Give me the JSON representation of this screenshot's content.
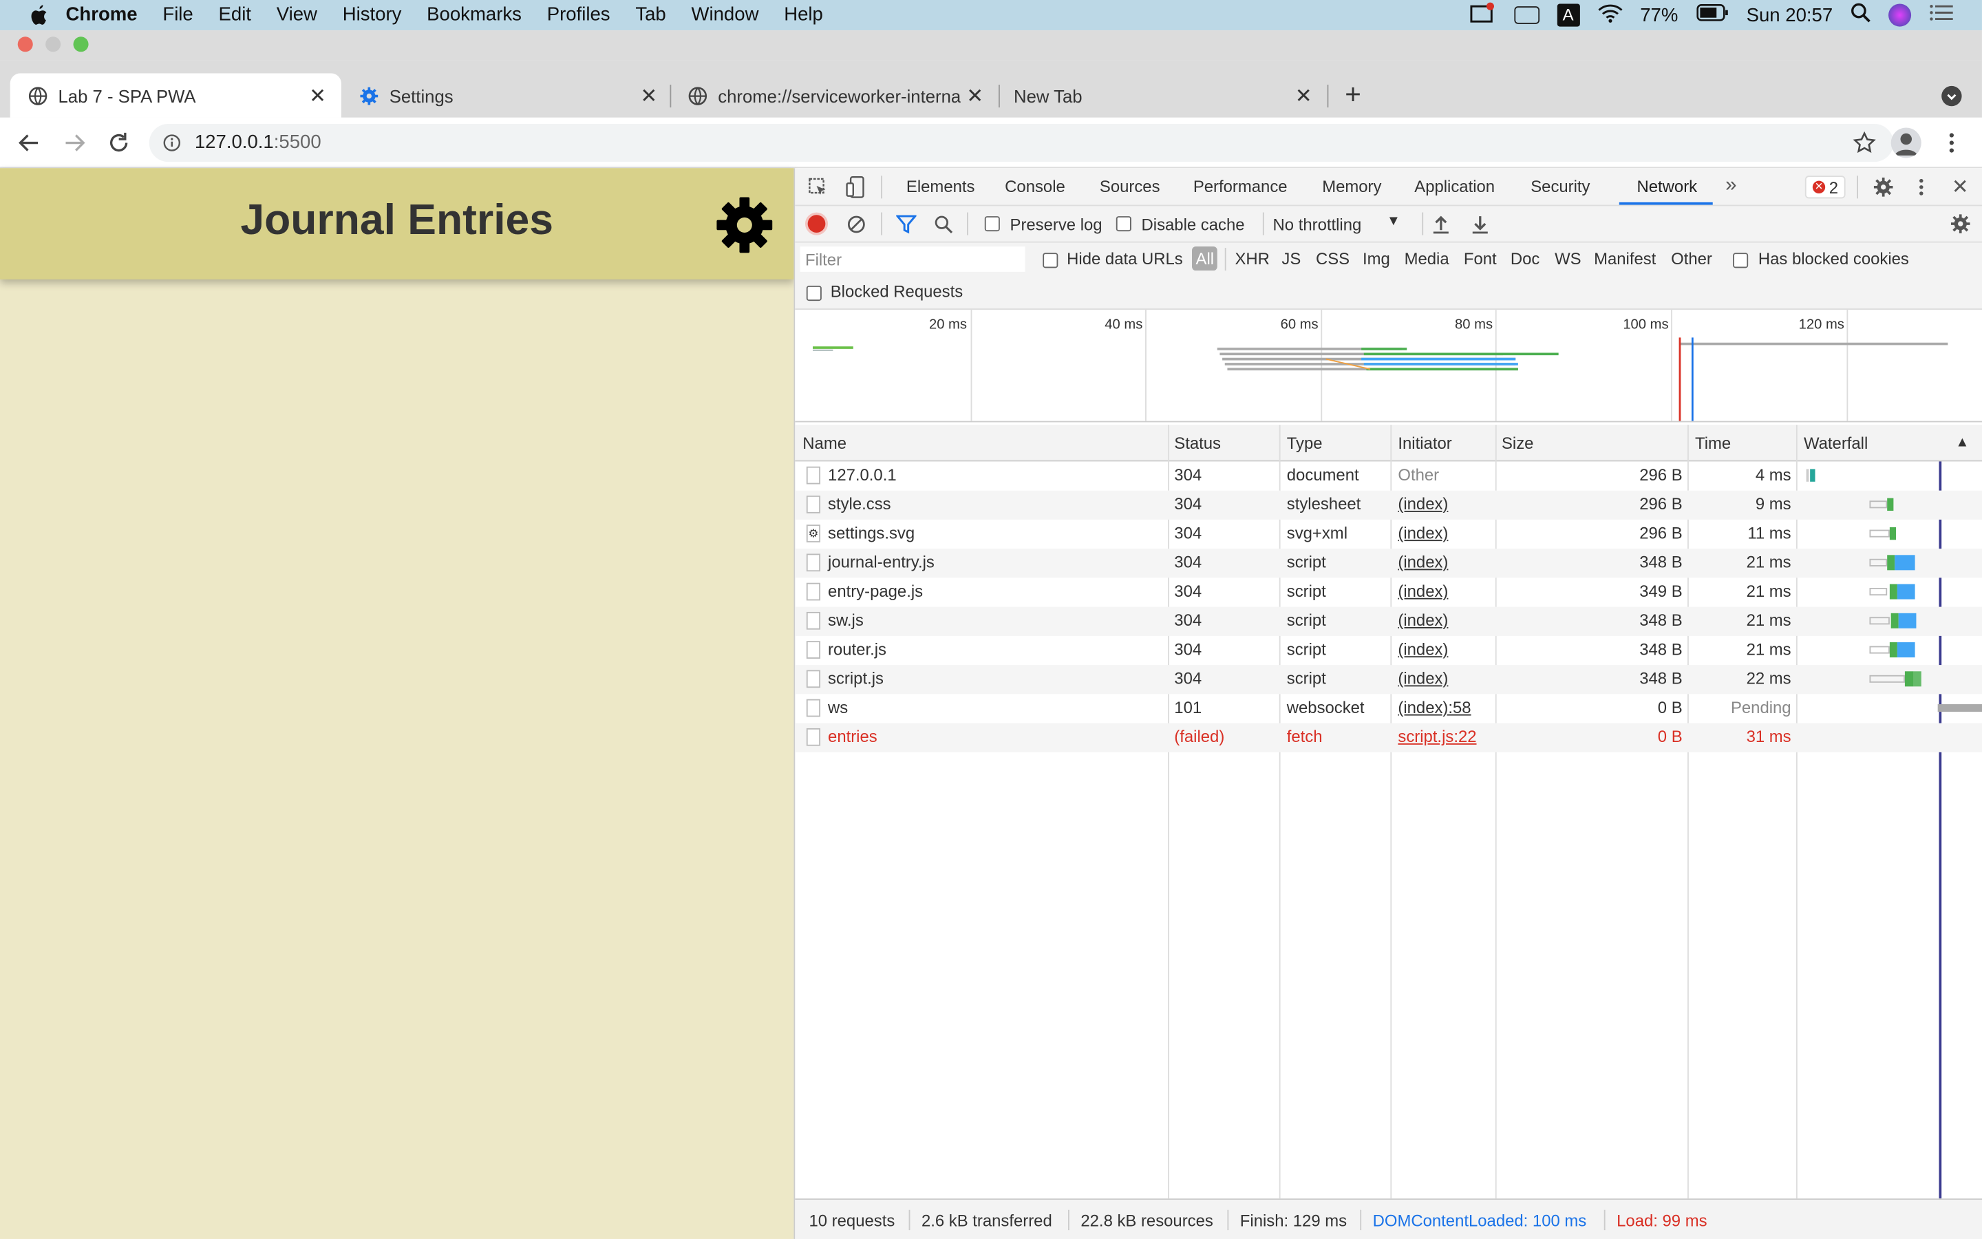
{
  "menubar": {
    "app": "Chrome",
    "items": [
      "File",
      "Edit",
      "View",
      "History",
      "Bookmarks",
      "Profiles",
      "Tab",
      "Window",
      "Help"
    ],
    "battery": "77%",
    "clock": "Sun 20:57"
  },
  "tabs": [
    {
      "label": "Lab 7 - SPA PWA",
      "icon": "globe-icon"
    },
    {
      "label": "Settings",
      "icon": "gear-icon"
    },
    {
      "label": "chrome://serviceworker-internals",
      "icon": "globe-icon"
    },
    {
      "label": "New Tab",
      "icon": ""
    }
  ],
  "address": {
    "host": "127.0.0.1",
    "port": ":5500"
  },
  "page": {
    "title": "Journal Entries"
  },
  "devtools": {
    "tabs": [
      "Elements",
      "Console",
      "Sources",
      "Performance",
      "Memory",
      "Application",
      "Security",
      "Network"
    ],
    "active_tab": "Network",
    "error_count": "2",
    "preserve_log": "Preserve log",
    "disable_cache": "Disable cache",
    "throttling": "No throttling",
    "filter_placeholder": "Filter",
    "hide_data_urls": "Hide data URLs",
    "filter_types": [
      "All",
      "XHR",
      "JS",
      "CSS",
      "Img",
      "Media",
      "Font",
      "Doc",
      "WS",
      "Manifest",
      "Other"
    ],
    "has_blocked_cookies": "Has blocked cookies",
    "blocked_requests": "Blocked Requests",
    "overview_ticks": [
      "20 ms",
      "40 ms",
      "60 ms",
      "80 ms",
      "100 ms",
      "120 ms"
    ],
    "columns": [
      "Name",
      "Status",
      "Type",
      "Initiator",
      "Size",
      "Time",
      "Waterfall"
    ],
    "rows": [
      {
        "name": "127.0.0.1",
        "status": "304",
        "type": "document",
        "initiator": "Other",
        "size": "296 B",
        "time": "4 ms"
      },
      {
        "name": "style.css",
        "status": "304",
        "type": "stylesheet",
        "initiator": "(index)",
        "size": "296 B",
        "time": "9 ms"
      },
      {
        "name": "settings.svg",
        "status": "304",
        "type": "svg+xml",
        "initiator": "(index)",
        "size": "296 B",
        "time": "11 ms"
      },
      {
        "name": "journal-entry.js",
        "status": "304",
        "type": "script",
        "initiator": "(index)",
        "size": "348 B",
        "time": "21 ms"
      },
      {
        "name": "entry-page.js",
        "status": "304",
        "type": "script",
        "initiator": "(index)",
        "size": "349 B",
        "time": "21 ms"
      },
      {
        "name": "sw.js",
        "status": "304",
        "type": "script",
        "initiator": "(index)",
        "size": "348 B",
        "time": "21 ms"
      },
      {
        "name": "router.js",
        "status": "304",
        "type": "script",
        "initiator": "(index)",
        "size": "348 B",
        "time": "21 ms"
      },
      {
        "name": "script.js",
        "status": "304",
        "type": "script",
        "initiator": "(index)",
        "size": "348 B",
        "time": "22 ms"
      },
      {
        "name": "ws",
        "status": "101",
        "type": "websocket",
        "initiator": "(index):58",
        "size": "0 B",
        "time": "Pending"
      },
      {
        "name": "entries",
        "status": "(failed)",
        "type": "fetch",
        "initiator": "script.js:22",
        "size": "0 B",
        "time": "31 ms"
      }
    ],
    "status": {
      "requests": "10 requests",
      "transferred": "2.6 kB transferred",
      "resources": "22.8 kB resources",
      "finish": "Finish: 129 ms",
      "dcl": "DOMContentLoaded: 100 ms",
      "load": "Load: 99 ms"
    }
  },
  "colors": {
    "page_bg": "#ede8c7",
    "header_bg": "#d8d18a",
    "accent_blue": "#1a73e8",
    "error_red": "#d93025"
  }
}
